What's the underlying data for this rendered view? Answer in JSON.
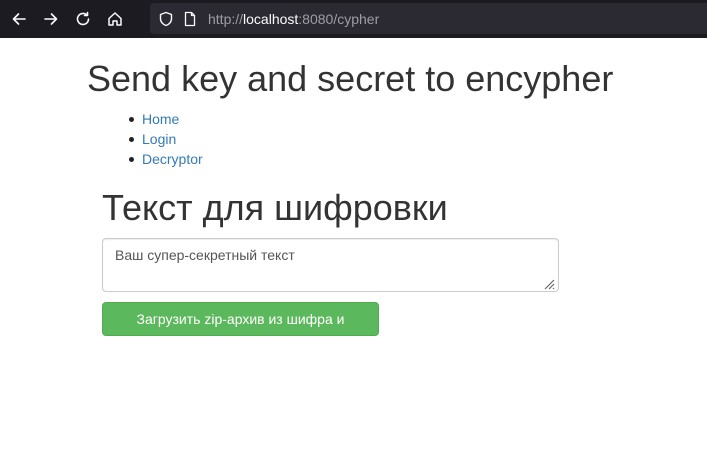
{
  "browser": {
    "url_prefix": "http://",
    "url_host": "localhost",
    "url_rest": ":8080/cypher",
    "icons": {
      "back": "back-arrow-icon",
      "forward": "forward-arrow-icon",
      "reload": "reload-icon",
      "home": "home-icon",
      "tracking": "shield-icon",
      "page_info": "page-icon"
    }
  },
  "page": {
    "title": "Send key and secret to encypher",
    "nav": [
      {
        "label": "Home"
      },
      {
        "label": "Login"
      },
      {
        "label": "Decryptor"
      }
    ],
    "section_title": "Текст для шифровки",
    "textarea": {
      "placeholder": "Ваш супер-секретный текст",
      "value": ""
    },
    "submit_label": "Загрузить zip-архив из шифра и ключа"
  },
  "colors": {
    "link": "#337ab7",
    "button": "#5cb85c",
    "browser_toolbar": "#1c1b22",
    "urlbar": "#2b2a33"
  }
}
